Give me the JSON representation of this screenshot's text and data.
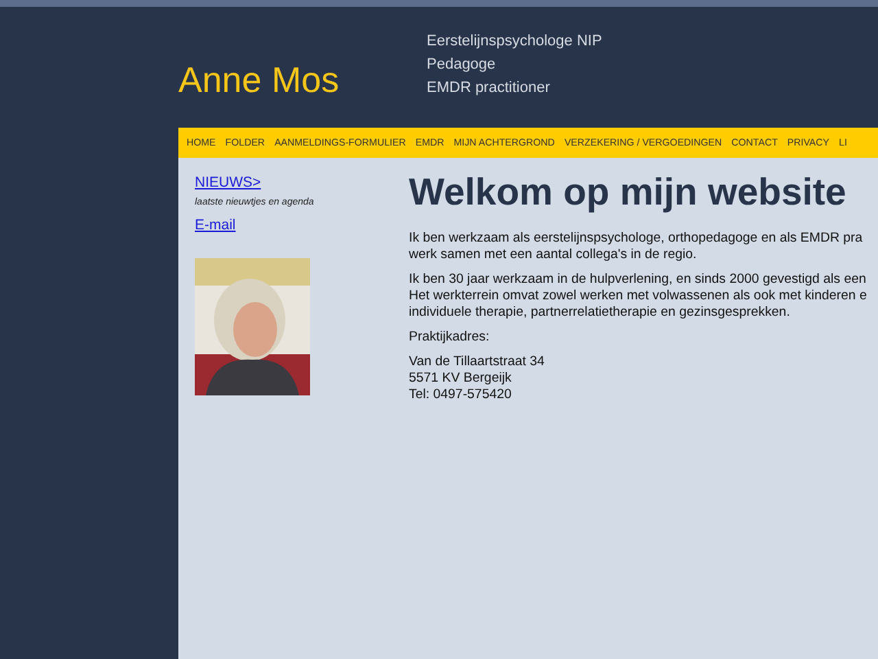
{
  "header": {
    "site_name": "Anne Mos",
    "roles": [
      "Eerstelijnspsychologe NIP",
      "Pedagoge",
      "EMDR practitioner"
    ]
  },
  "nav": [
    "HOME",
    "FOLDER",
    "AANMELDINGS-FORMULIER",
    "EMDR",
    "MIJN ACHTERGROND",
    "VERZEKERING / VERGOEDINGEN",
    "CONTACT",
    "PRIVACY",
    "LI"
  ],
  "sidebar": {
    "news_link": "NIEUWS>",
    "news_caption": "laatste nieuwtjes en agenda",
    "email_link": "E-mail"
  },
  "main": {
    "title": "Welkom op mijn website",
    "paragraphs": [
      [
        "Ik ben werkzaam als eerstelijnspsychologe, orthopedagoge en als EMDR pra",
        "werk samen met een aantal collega's in de regio."
      ],
      [
        "Ik ben 30 jaar werkzaam in de hulpverlening, en sinds 2000 gevestigd als een",
        "Het werkterrein omvat zowel werken met volwassenen als ook met kinderen e",
        "individuele therapie, partnerrelatietherapie en gezinsgesprekken."
      ],
      [
        "Praktijkadres:"
      ],
      [
        "Van de Tillaartstraat 34",
        "5571 KV Bergeijk",
        "Tel: 0497-575420"
      ]
    ]
  }
}
